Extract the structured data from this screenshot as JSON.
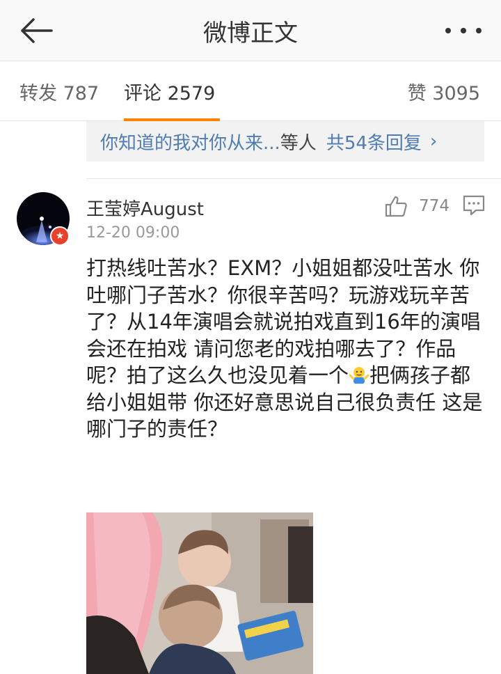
{
  "header": {
    "back_icon": "arrow-left-icon",
    "title": "微博正文",
    "more_icon": "more-dots-icon"
  },
  "tabs": {
    "repost": "转发 787",
    "comments": "评论 2579",
    "likes": "赞 3095",
    "active": "comments",
    "accent": "#ff8200"
  },
  "reply_summary": {
    "preview_text": "你知道的我对你从来...",
    "author": "等人",
    "count_text": "共54条回复",
    "chevron": "›",
    "link_color": "#507daf"
  },
  "comment": {
    "username": "王莹婷August",
    "timestamp": "12-20 09:00",
    "like_count": "774",
    "like_icon": "thumbs-up-icon",
    "reply_icon": "comment-reply-icon",
    "text_part1": "打热线吐苦水？EXM？小姐姐都没吐苦水 你吐哪门子苦水？你很辛苦吗？玩游戏玩辛苦了？从14年演唱会就说拍戏直到16年的演唱会还在拍戏 请问您老的戏拍哪去了？作品呢？拍了这么久也没见着一个",
    "emoji": "shrug-emoji-icon",
    "text_part2": "把俩孩子都给小姐姐带 你还好意思说自己很负责任 这是哪门子的责任？",
    "avatar_badge": "★"
  }
}
